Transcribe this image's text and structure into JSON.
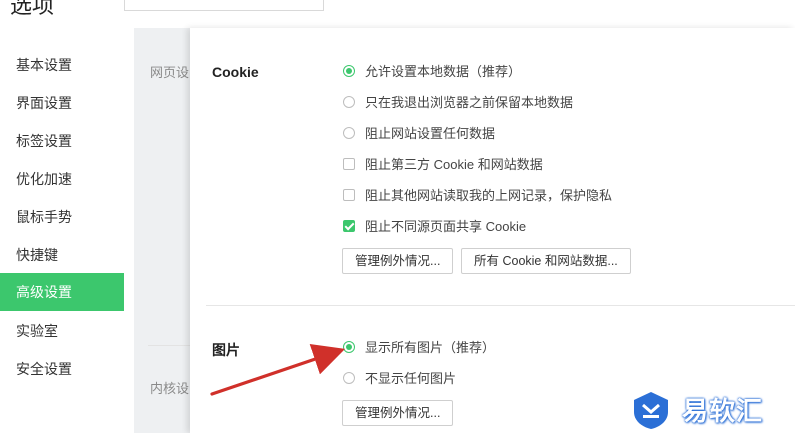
{
  "header": {
    "title": "选项"
  },
  "sidebar": {
    "items": [
      {
        "label": "基本设置"
      },
      {
        "label": "界面设置"
      },
      {
        "label": "标签设置"
      },
      {
        "label": "优化加速"
      },
      {
        "label": "鼠标手势"
      },
      {
        "label": "快捷键"
      },
      {
        "label": "高级设置",
        "active": true
      },
      {
        "label": "实验室"
      },
      {
        "label": "安全设置"
      }
    ]
  },
  "mid": {
    "labels": [
      "网页设",
      "内核设"
    ]
  },
  "cookie": {
    "title": "Cookie",
    "options": [
      {
        "type": "radio",
        "checked": true,
        "label": "允许设置本地数据（推荐）"
      },
      {
        "type": "radio",
        "checked": false,
        "label": "只在我退出浏览器之前保留本地数据"
      },
      {
        "type": "radio",
        "checked": false,
        "label": "阻止网站设置任何数据"
      },
      {
        "type": "checkbox",
        "checked": false,
        "label": "阻止第三方 Cookie 和网站数据"
      },
      {
        "type": "checkbox",
        "checked": false,
        "label": "阻止其他网站读取我的上网记录，保护隐私"
      },
      {
        "type": "checkbox",
        "checked": true,
        "label": "阻止不同源页面共享 Cookie"
      }
    ],
    "buttons": [
      "管理例外情况...",
      "所有 Cookie 和网站数据..."
    ]
  },
  "images": {
    "title": "图片",
    "options": [
      {
        "type": "radio",
        "checked": true,
        "label": "显示所有图片（推荐）"
      },
      {
        "type": "radio",
        "checked": false,
        "label": "不显示任何图片"
      }
    ],
    "buttons": [
      "管理例外情况..."
    ]
  },
  "watermark": {
    "text": "易软汇"
  },
  "colors": {
    "accent": "#3cc76d",
    "arrow": "#d0302a",
    "watermark": "#2b6fd6"
  }
}
